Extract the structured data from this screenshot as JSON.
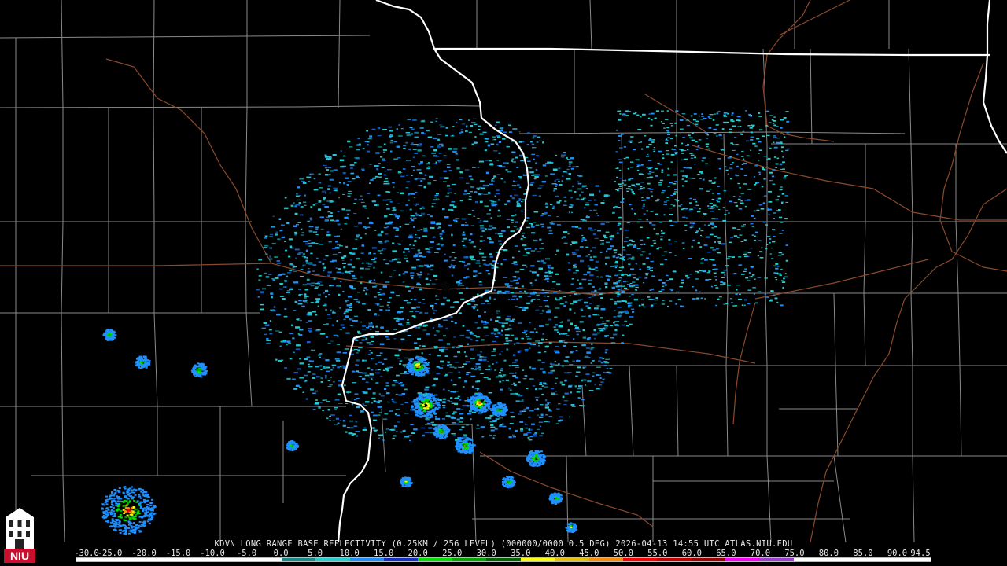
{
  "product_caption": "KDVN LONG RANGE BASE REFLECTIVITY (0.25KM / 256 LEVEL) (000000/0000 0.5 DEG) 2026-04-13 14:55 UTC  ATLAS.NIU.EDU",
  "scale": {
    "labels": [
      "-30.0",
      "-25.0",
      "-20.0",
      "-15.0",
      "-10.0",
      "-5.0",
      "0.0",
      "5.0",
      "10.0",
      "15.0",
      "20.0",
      "25.0",
      "30.0",
      "35.0",
      "40.0",
      "45.0",
      "50.0",
      "55.0",
      "60.0",
      "65.0",
      "70.0",
      "75.0",
      "80.0",
      "85.0",
      "90.0",
      "94.5"
    ],
    "colors": [
      "#ffffff",
      "#ffffff",
      "#ffffff",
      "#ffffff",
      "#ffffff",
      "#ffffff",
      "#1a8a8a",
      "#1fd1d1",
      "#1e90ff",
      "#1432c8",
      "#00e000",
      "#00a800",
      "#006400",
      "#ffff00",
      "#e8c000",
      "#ff8c00",
      "#ff0000",
      "#c80000",
      "#a00000",
      "#ff00ff",
      "#a040d0",
      "#ffffff",
      "#ffffff",
      "#ffffff",
      "#ffffff"
    ]
  },
  "logo": {
    "text": "NIU",
    "color": "#c8102e"
  },
  "map": {
    "background": "#000000",
    "county_line_color": "#8a8a8a",
    "highway_color": "#8b4a2b",
    "state_border_color": "#ffffff"
  }
}
